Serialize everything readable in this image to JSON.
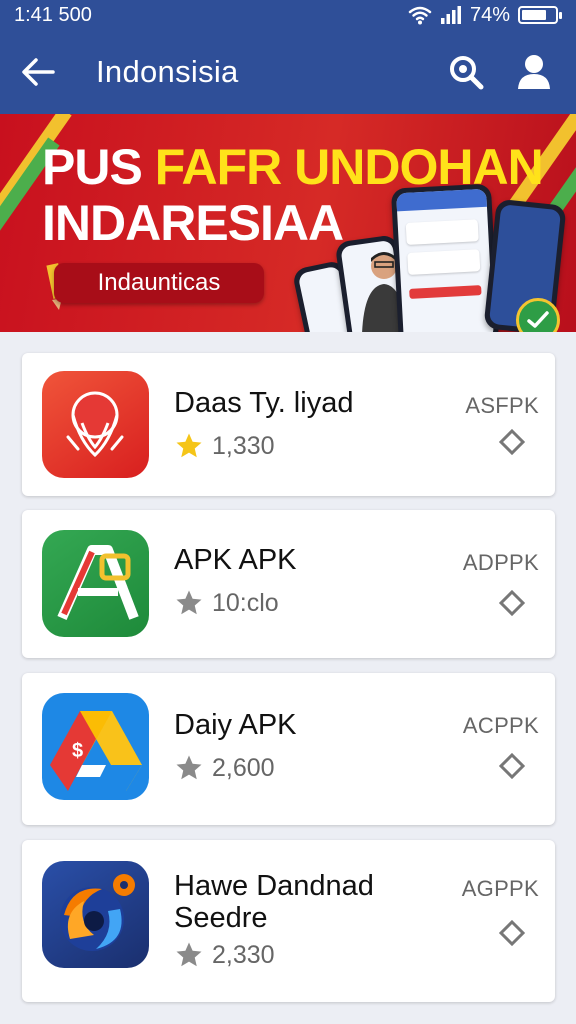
{
  "status_bar": {
    "time": "1:41 500",
    "battery": "74%",
    "battery_level": 0.74
  },
  "app_bar": {
    "title": "Indonsisia",
    "back_icon": "arrow-left-icon",
    "search_icon": "search-icon",
    "profile_icon": "person-icon"
  },
  "banner": {
    "headline_white": "PUS ",
    "headline_yellow": "FAFR UNDOHAN",
    "headline_line2": "INDARESIAA",
    "pill_label": "Indaunticas",
    "colors": {
      "background": "#d0161f",
      "highlight": "#ffe21a"
    }
  },
  "apps": [
    {
      "name": "Daas Ty. liyad",
      "rating": "1,330",
      "tag": "ASFPK",
      "star_color": "#f5c518",
      "icon": "red-ornament-icon"
    },
    {
      "name": "APK APK",
      "rating": "10:clo",
      "tag": "ADPPK",
      "star_color": "#8a8a8a",
      "icon": "green-letter-a-icon"
    },
    {
      "name": "Daiy APK",
      "rating": "2,600",
      "tag": "ACPPK",
      "star_color": "#8a8a8a",
      "icon": "drive-triangle-icon"
    },
    {
      "name_line1": "Hawe Dandnad",
      "name_line2": "Seedre",
      "rating": "2,330",
      "tag": "AGPPK",
      "star_color": "#8a8a8a",
      "icon": "swirl-gear-icon"
    }
  ]
}
